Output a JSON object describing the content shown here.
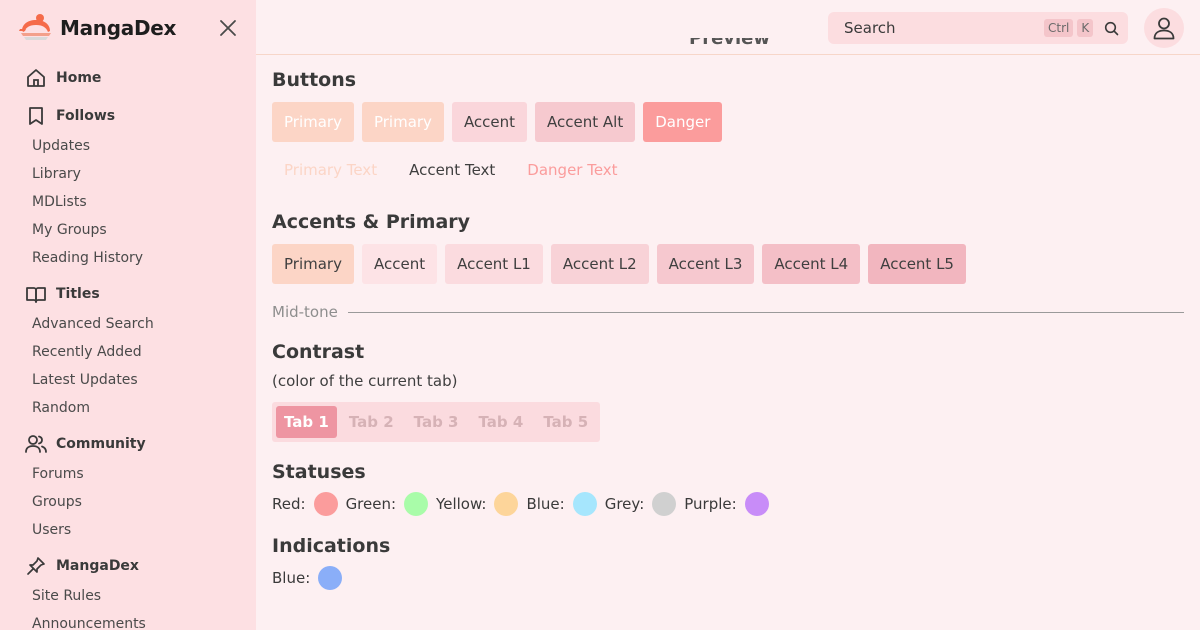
{
  "brand": {
    "name": "MangaDex"
  },
  "nav": {
    "home": "Home",
    "follows": {
      "label": "Follows",
      "items": [
        "Updates",
        "Library",
        "MDLists",
        "My Groups",
        "Reading History"
      ]
    },
    "titles": {
      "label": "Titles",
      "items": [
        "Advanced Search",
        "Recently Added",
        "Latest Updates",
        "Random"
      ]
    },
    "community": {
      "label": "Community",
      "items": [
        "Forums",
        "Groups",
        "Users"
      ]
    },
    "mangadex": {
      "label": "MangaDex",
      "items": [
        "Site Rules",
        "Announcements"
      ]
    }
  },
  "search": {
    "placeholder": "Search",
    "kbd1": "Ctrl",
    "kbd2": "K"
  },
  "preview_label": "Preview",
  "buttons": {
    "title": "Buttons",
    "filled": [
      {
        "label": "Primary",
        "bg": "#fcd5c6",
        "color": "#ffffff"
      },
      {
        "label": "Primary",
        "bg": "#fcd5c6",
        "color": "#ffffff"
      },
      {
        "label": "Accent",
        "bg": "#fad6db",
        "color": "#3f3f3f"
      },
      {
        "label": "Accent Alt",
        "bg": "#f6c9cf",
        "color": "#3f3f3f"
      },
      {
        "label": "Danger",
        "bg": "#fb9c9c",
        "color": "#ffffff"
      }
    ],
    "text": [
      {
        "label": "Primary Text",
        "color": "#fcd5c6"
      },
      {
        "label": "Accent Text",
        "color": "#3f3f3f"
      },
      {
        "label": "Danger Text",
        "color": "#fb9c9c"
      }
    ]
  },
  "accents": {
    "title": "Accents & Primary",
    "items": [
      {
        "label": "Primary",
        "bg": "#fcd5c6"
      },
      {
        "label": "Accent",
        "bg": "#fde3e6"
      },
      {
        "label": "Accent L1",
        "bg": "#fbdbdf"
      },
      {
        "label": "Accent L2",
        "bg": "#f8d2d7"
      },
      {
        "label": "Accent L3",
        "bg": "#f6c8cf"
      },
      {
        "label": "Accent L4",
        "bg": "#f4bfc7"
      },
      {
        "label": "Accent L5",
        "bg": "#f2b6bf"
      }
    ]
  },
  "midtone": {
    "label": "Mid-tone"
  },
  "contrast": {
    "title": "Contrast",
    "subtitle": "(color of the current tab)",
    "tabs": [
      "Tab 1",
      "Tab 2",
      "Tab 3",
      "Tab 4",
      "Tab 5"
    ]
  },
  "statuses": {
    "title": "Statuses",
    "items": [
      {
        "label": "Red:",
        "color": "#fb9c9c"
      },
      {
        "label": "Green:",
        "color": "#a9fca9"
      },
      {
        "label": "Yellow:",
        "color": "#fdd59a"
      },
      {
        "label": "Blue:",
        "color": "#a6e6fd"
      },
      {
        "label": "Grey:",
        "color": "#d0d0d0"
      },
      {
        "label": "Purple:",
        "color": "#c88cf8"
      }
    ]
  },
  "indications": {
    "title": "Indications",
    "items": [
      {
        "label": "Blue:",
        "color": "#8aaef8"
      }
    ]
  }
}
